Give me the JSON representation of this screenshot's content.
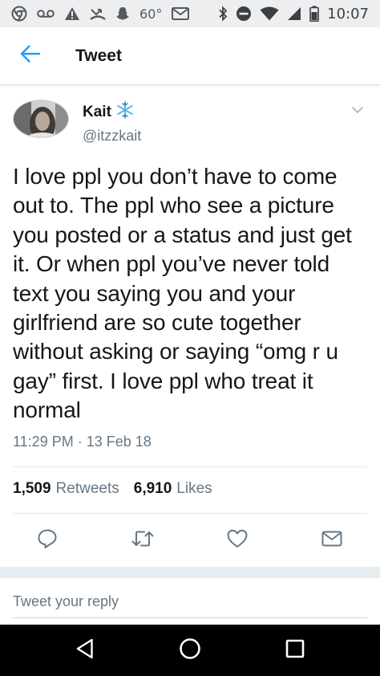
{
  "status_bar": {
    "temperature": "60°",
    "time": "10:07",
    "icons": [
      "chrome-icon",
      "voicemail-icon",
      "warning-icon",
      "missed-call-icon",
      "snapchat-icon",
      "gmail-icon",
      "bluetooth-icon",
      "do-not-disturb-icon",
      "wifi-icon",
      "signal-icon",
      "battery-icon"
    ]
  },
  "header": {
    "title": "Tweet",
    "back_icon": "back-arrow-icon"
  },
  "author": {
    "display_name": "Kait",
    "emoji": "❄️",
    "handle": "@itzzkait"
  },
  "tweet": {
    "text": "I love ppl you don’t have to come out to. The ppl who see a picture you posted or a status and just get it. Or when ppl you’ve never told text you saying you and your girlfriend are so cute together without asking or saying “omg r u gay” first. I love ppl who treat it normal",
    "timestamp": "11:29 PM · 13 Feb 18"
  },
  "stats": {
    "retweets_count": "1,509",
    "retweets_label": "Retweets",
    "likes_count": "6,910",
    "likes_label": "Likes"
  },
  "actions": [
    "reply-icon",
    "retweet-icon",
    "like-icon",
    "share-icon"
  ],
  "reply": {
    "placeholder": "Tweet your reply"
  },
  "nav": [
    "back-triangle-icon",
    "home-circle-icon",
    "recents-square-icon"
  ],
  "colors": {
    "twitter_blue": "#1da1f2",
    "text_primary": "#14171a",
    "text_secondary": "#657786",
    "status_bar_bg": "#eceef0",
    "nav_bar_bg": "#000000"
  }
}
